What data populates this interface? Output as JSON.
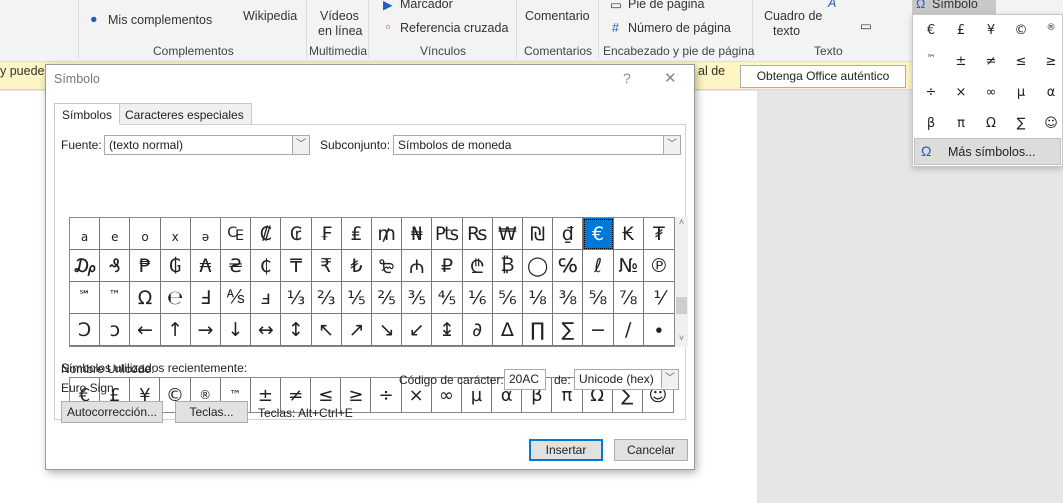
{
  "ribbon": {
    "mis_complementos": "Mis complementos",
    "wikipedia": "Wikipedia",
    "videos": "Vídeos",
    "en_linea": "en línea",
    "marcador": "Marcador",
    "referencia": "Referencia cruzada",
    "comentario": "Comentario",
    "pie": "Pie de página",
    "numero": "Número de página",
    "cuadro1": "Cuadro de",
    "cuadro2": "texto",
    "simbolo": "Símbolo",
    "groups": [
      "Complementos",
      "Multimedia",
      "Vínculos",
      "Comentarios",
      "Encabezado y pie de página",
      "Texto"
    ]
  },
  "infobar": {
    "text_left": "y puede s",
    "text_right": "al de",
    "button": "Obtenga Office auténtico"
  },
  "dialog": {
    "title": "Símbolo",
    "help": "?",
    "close": "✕",
    "tabs": [
      "Símbolos",
      "Caracteres especiales"
    ],
    "font_label": "Fuente:",
    "font_value": "(texto normal)",
    "subset_label": "Subconjunto:",
    "subset_value": "Símbolos de moneda",
    "grid": [
      [
        "a",
        "e",
        "o",
        "x",
        "ə",
        "₠",
        "₡",
        "₢",
        "₣",
        "₤",
        "₥",
        "₦",
        "₧",
        "₨",
        "₩",
        "₪",
        "₫",
        "€",
        "₭",
        "₮"
      ],
      [
        "₯",
        "₰",
        "₱",
        "₲",
        "₳",
        "₴",
        "₵",
        "₸",
        "₹",
        "₺",
        "₻",
        "₼",
        "₽",
        "₾",
        "₿",
        "◯",
        "℅",
        "ℓ",
        "№",
        "℗"
      ],
      [
        "℠",
        "™",
        "Ω",
        "℮",
        "Ⅎ",
        "⅍",
        "ⅎ",
        "⅓",
        "⅔",
        "⅕",
        "⅖",
        "⅗",
        "⅘",
        "⅙",
        "⅚",
        "⅛",
        "⅜",
        "⅝",
        "⅞",
        "⅟"
      ],
      [
        "Ↄ",
        "ↄ",
        "←",
        "↑",
        "→",
        "↓",
        "↔",
        "↕",
        "↖",
        "↗",
        "↘",
        "↙",
        "↨",
        "∂",
        "∆",
        "∏",
        "∑",
        "−",
        "∕",
        "∙"
      ]
    ],
    "selected": "€",
    "recent_label": "Símbolos utilizados recientemente:",
    "recent": [
      "€",
      "£",
      "¥",
      "©",
      "®",
      "™",
      "±",
      "≠",
      "≤",
      "≥",
      "÷",
      "×",
      "∞",
      "µ",
      "α",
      "β",
      "π",
      "Ω",
      "∑",
      "☺"
    ],
    "unicode_name_label": "Nombre Unicode:",
    "unicode_name": "Euro Sign",
    "code_label": "Código de carácter:",
    "code_value": "20AC",
    "from_label": "de:",
    "from_value": "Unicode (hex)",
    "autocorrect": "Autocorrección...",
    "keys": "Teclas...",
    "shortcut": "Teclas: Alt+Ctrl+E",
    "insert": "Insertar",
    "cancel": "Cancelar"
  },
  "dropdown": {
    "symbols": [
      "€",
      "£",
      "¥",
      "©",
      "®",
      "™",
      "±",
      "≠",
      "≤",
      "≥",
      "÷",
      "×",
      "∞",
      "µ",
      "α",
      "β",
      "π",
      "Ω",
      "∑",
      "☺"
    ],
    "more_icon": "Ω",
    "more": "Más símbolos..."
  },
  "colors": {
    "accent": "#0078d7",
    "infobar": "#fdf5c4"
  }
}
